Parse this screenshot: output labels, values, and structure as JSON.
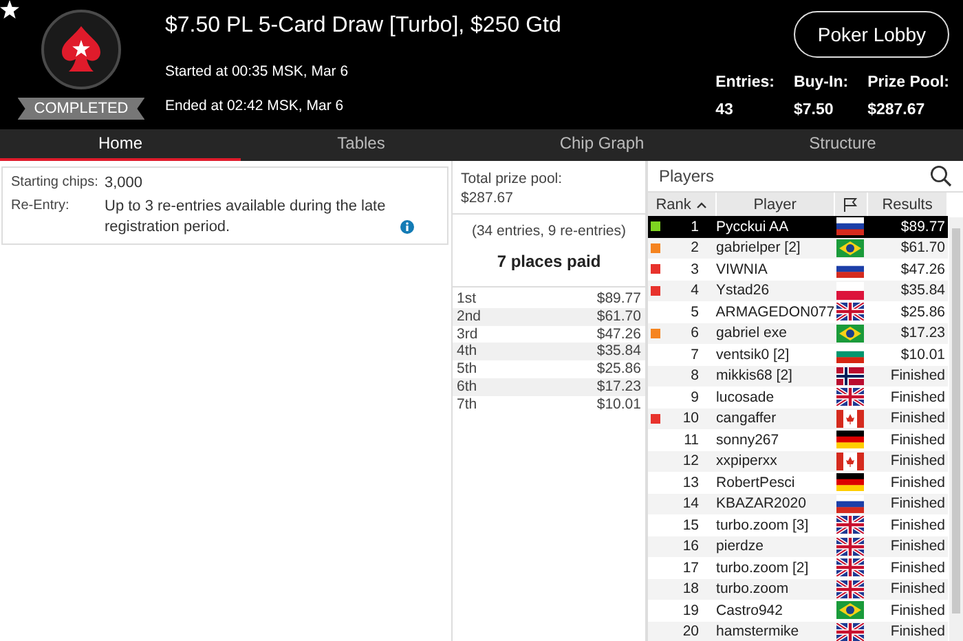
{
  "header": {
    "status": "COMPLETED",
    "title": "$7.50 PL 5-Card Draw [Turbo], $250 Gtd",
    "started": "Started at 00:35 MSK, Mar 6",
    "ended": "Ended at 02:42 MSK, Mar 6",
    "lobby_button": "Poker Lobby",
    "stats": [
      {
        "label": "Entries:",
        "value": "43"
      },
      {
        "label": "Buy-In:",
        "value": "$7.50"
      },
      {
        "label": "Prize Pool:",
        "value": "$287.67"
      }
    ]
  },
  "tabs": [
    {
      "label": "Home",
      "selected": true
    },
    {
      "label": "Tables",
      "selected": false
    },
    {
      "label": "Chip Graph",
      "selected": false
    },
    {
      "label": "Structure",
      "selected": false
    }
  ],
  "info": [
    {
      "label": "Starting chips:",
      "value": "3,000",
      "info_icon": false
    },
    {
      "label": "Re-Entry:",
      "value": "Up to 3 re-entries available during the late registration period.",
      "info_icon": true
    }
  ],
  "prizes": {
    "total_label": "Total prize pool:",
    "total": "$287.67",
    "entries_note": "(34 entries, 9 re-entries)",
    "places_paid": "7 places paid",
    "rows": [
      {
        "place": "1st",
        "amount": "$89.77"
      },
      {
        "place": "2nd",
        "amount": "$61.70"
      },
      {
        "place": "3rd",
        "amount": "$47.26"
      },
      {
        "place": "4th",
        "amount": "$35.84"
      },
      {
        "place": "5th",
        "amount": "$25.86"
      },
      {
        "place": "6th",
        "amount": "$17.23"
      },
      {
        "place": "7th",
        "amount": "$10.01"
      }
    ]
  },
  "players": {
    "title": "Players",
    "columns": [
      "Rank",
      "Player",
      "Results"
    ],
    "rows": [
      {
        "rank": "1",
        "name": "Pycckui AA",
        "kind": "ru",
        "result": "$89.77",
        "color": "#7ed321",
        "selected": true
      },
      {
        "rank": "2",
        "name": "gabrielper [2]",
        "kind": "br",
        "result": "$61.70",
        "color": "#f5841f",
        "selected": false
      },
      {
        "rank": "3",
        "name": "VIWNIA",
        "kind": "ru",
        "result": "$47.26",
        "color": "#e8322c",
        "selected": false
      },
      {
        "rank": "4",
        "name": "Ystad26",
        "kind": "pl",
        "result": "$35.84",
        "color": "#e8322c",
        "selected": false
      },
      {
        "rank": "5",
        "name": "ARMAGEDON077",
        "kind": "gb",
        "result": "$25.86",
        "selected": false
      },
      {
        "rank": "6",
        "name": "gabriel exe",
        "kind": "br",
        "result": "$17.23",
        "color": "#f5841f",
        "selected": false
      },
      {
        "rank": "7",
        "name": "ventsik0 [2]",
        "kind": "bg",
        "result": "$10.01",
        "selected": false
      },
      {
        "rank": "8",
        "name": "mikkis68 [2]",
        "kind": "no",
        "result": "Finished",
        "selected": false
      },
      {
        "rank": "9",
        "name": "lucosade",
        "kind": "gb",
        "result": "Finished",
        "selected": false
      },
      {
        "rank": "10",
        "name": "cangaffer",
        "kind": "ca",
        "result": "Finished",
        "color": "#e8322c",
        "selected": false
      },
      {
        "rank": "11",
        "name": "sonny267",
        "kind": "de",
        "result": "Finished",
        "selected": false
      },
      {
        "rank": "12",
        "name": "xxpiperxx",
        "kind": "ca",
        "result": "Finished",
        "selected": false
      },
      {
        "rank": "13",
        "name": "RobertPesci",
        "kind": "de",
        "result": "Finished",
        "selected": false
      },
      {
        "rank": "14",
        "name": "KBAZAR2020",
        "kind": "ru",
        "result": "Finished",
        "selected": false
      },
      {
        "rank": "15",
        "name": "turbo.zoom [3]",
        "kind": "gb",
        "result": "Finished",
        "selected": false
      },
      {
        "rank": "16",
        "name": "pierdze",
        "kind": "gb",
        "result": "Finished",
        "selected": false
      },
      {
        "rank": "17",
        "name": "turbo.zoom [2]",
        "kind": "gb",
        "result": "Finished",
        "selected": false
      },
      {
        "rank": "18",
        "name": "turbo.zoom",
        "kind": "gb",
        "result": "Finished",
        "selected": false
      },
      {
        "rank": "19",
        "name": "Castro942",
        "kind": "br",
        "result": "Finished",
        "selected": false
      },
      {
        "rank": "20",
        "name": "hamstermike",
        "kind": "gb",
        "result": "Finished",
        "selected": false
      }
    ]
  }
}
